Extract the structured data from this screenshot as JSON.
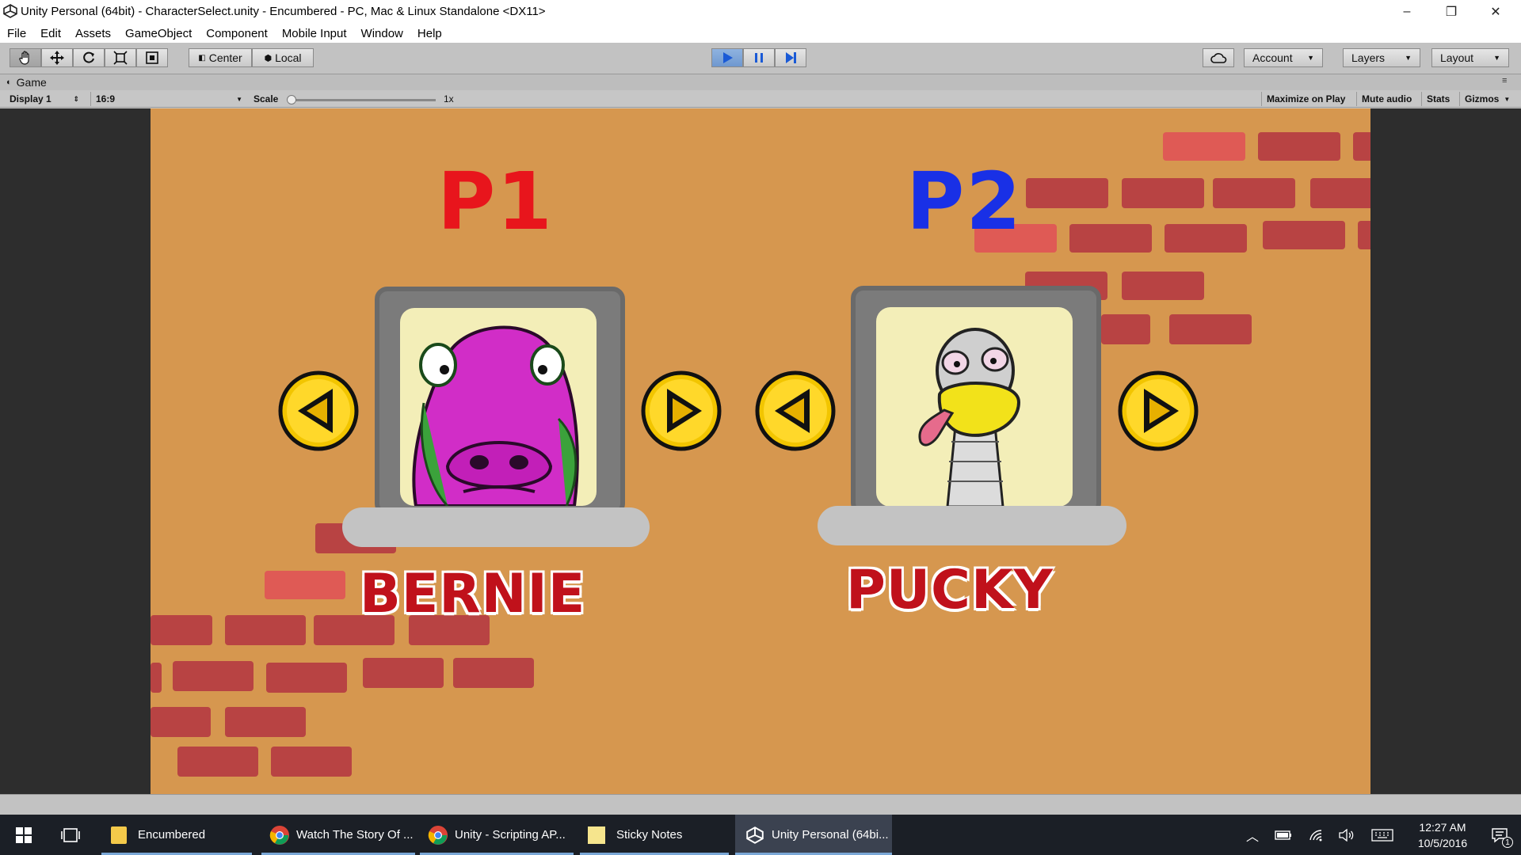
{
  "window": {
    "title": "Unity Personal (64bit) - CharacterSelect.unity - Encumbered - PC, Mac & Linux Standalone <DX11>",
    "minimize": "–",
    "restore": "❐",
    "close": "✕"
  },
  "menu": [
    "File",
    "Edit",
    "Assets",
    "GameObject",
    "Component",
    "Mobile Input",
    "Window",
    "Help"
  ],
  "toolbar": {
    "pivot_label": "Center",
    "space_label": "Local",
    "account_label": "Account",
    "layers_label": "Layers",
    "layout_label": "Layout",
    "play_state": "playing"
  },
  "game_tab": {
    "tab_label": "Game",
    "display": "Display 1",
    "aspect": "16:9",
    "scale_label": "Scale",
    "scale_value": "1x",
    "maximize": "Maximize on Play",
    "mute": "Mute audio",
    "stats": "Stats",
    "gizmos": "Gizmos"
  },
  "game": {
    "p1": {
      "label": "P1",
      "color": "#e8151c",
      "character": "BERNIE"
    },
    "p2": {
      "label": "P2",
      "color": "#1930e6",
      "character": "PUCKY"
    }
  },
  "taskbar": {
    "items": [
      {
        "label": "Encumbered",
        "icon": "folder-icon"
      },
      {
        "label": "Watch The Story Of ...",
        "icon": "chrome-icon"
      },
      {
        "label": "Unity - Scripting AP...",
        "icon": "chrome-icon"
      },
      {
        "label": "Sticky Notes",
        "icon": "sticky-notes-icon"
      },
      {
        "label": "Unity Personal (64bi...",
        "icon": "unity-icon"
      }
    ],
    "time": "12:27 AM",
    "date": "10/5/2016",
    "notifications": "1"
  },
  "colors": {
    "game_background": "#d6974f",
    "brick": "#b84343",
    "name_text": "#c0111b",
    "arrow": "#f2c500"
  }
}
